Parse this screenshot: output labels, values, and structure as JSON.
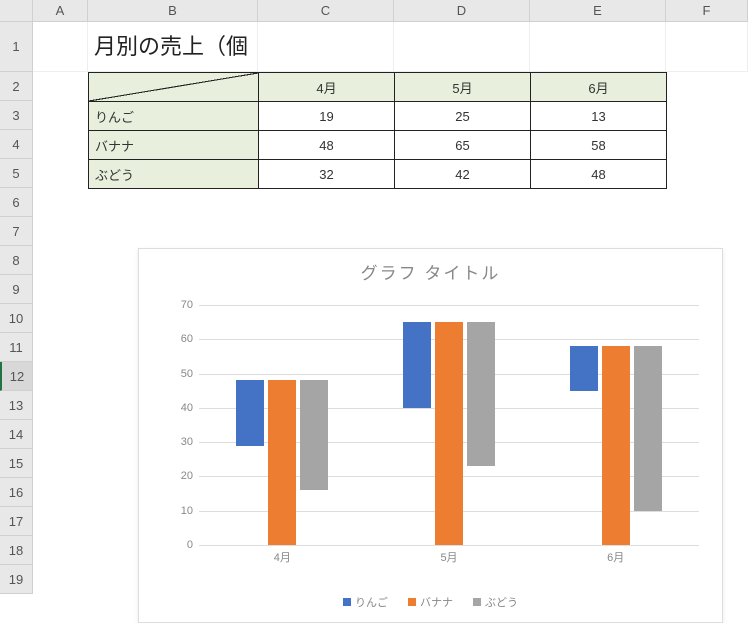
{
  "columns": [
    "A",
    "B",
    "C",
    "D",
    "E",
    "F"
  ],
  "rows": [
    "1",
    "2",
    "3",
    "4",
    "5",
    "6",
    "7",
    "8",
    "9",
    "10",
    "11",
    "12",
    "13",
    "14",
    "15",
    "16",
    "17",
    "18",
    "19"
  ],
  "selected_row": "12",
  "title": "月別の売上（個数）",
  "table": {
    "col_headers": [
      "4月",
      "5月",
      "6月"
    ],
    "row_headers": [
      "りんご",
      "バナナ",
      "ぶどう"
    ],
    "values": [
      [
        19,
        25,
        13
      ],
      [
        48,
        65,
        58
      ],
      [
        32,
        42,
        48
      ]
    ]
  },
  "chart_data": {
    "type": "bar",
    "title": "グラフ タイトル",
    "categories": [
      "4月",
      "5月",
      "6月"
    ],
    "series": [
      {
        "name": "りんご",
        "values": [
          19,
          25,
          13
        ],
        "color": "#4472c4"
      },
      {
        "name": "バナナ",
        "values": [
          48,
          65,
          58
        ],
        "color": "#ed7d31"
      },
      {
        "name": "ぶどう",
        "values": [
          32,
          42,
          48
        ],
        "color": "#a5a5a5"
      }
    ],
    "ylim": [
      0,
      70
    ],
    "yticks": [
      0,
      10,
      20,
      30,
      40,
      50,
      60,
      70
    ]
  }
}
